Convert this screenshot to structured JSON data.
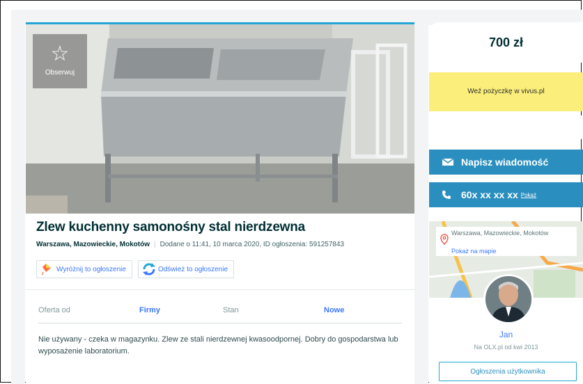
{
  "listing": {
    "title": "Zlew kuchenny samonośny stal nierdzewna",
    "location": "Warszawa, Mazowieckie, Mokotów",
    "added_info": "Dodane o 11:41, 10 marca 2020, ID ogłoszenia: 591257843",
    "observe_label": "Obserwuj",
    "promote_label": "Wyróżnij to ogłoszenie",
    "refresh_label": "Odśwież to ogłoszenie",
    "properties": [
      {
        "key": "Oferta od",
        "value": "Firmy"
      },
      {
        "key": "Stan",
        "value": "Nowe"
      }
    ],
    "description": "Nie używany - czeka w magazynku. Zlew ze stali nierdzewnej kwasoodpornej. Dobry do gospodarstwa lub wyposażenie laboratorium."
  },
  "sidebar": {
    "price": "700 zł",
    "loan_ad": "Weź pożyczkę w vivus.pl",
    "message_button": "Napisz wiadomość",
    "phone_number": "60x xx xx xx",
    "phone_show": "Pokaż",
    "map_location": "Warszawa, Mazowieckie, Mokotów",
    "map_link": "Pokaż na mapie",
    "user_name": "Jan",
    "user_since": "Na OLX.pl od kwi 2013",
    "user_ads_button": "Ogłoszenia użytkownika"
  },
  "colors": {
    "accent_blue": "#2a8fbf",
    "link_blue": "#3a77ff",
    "loan_yellow": "#fcee7a",
    "photo_top_border": "#23a6d5"
  }
}
